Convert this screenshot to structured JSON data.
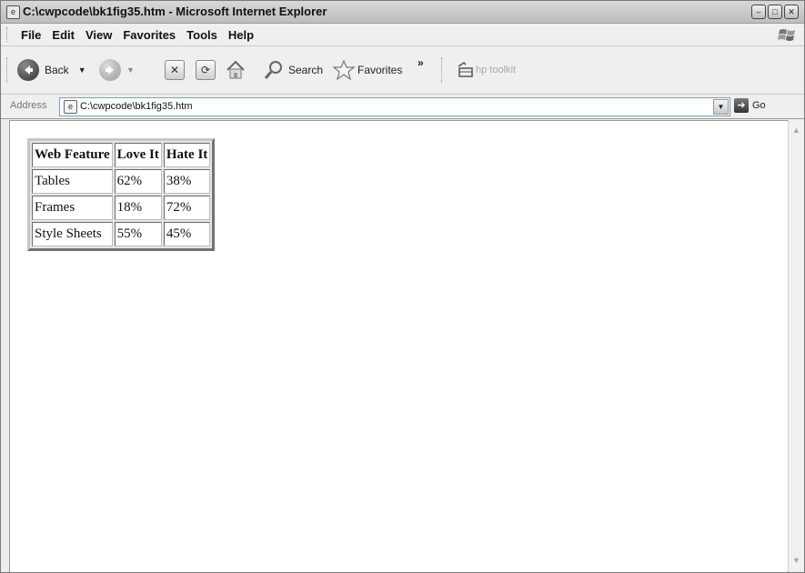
{
  "window": {
    "title": "C:\\cwpcode\\bk1fig35.htm - Microsoft Internet Explorer",
    "controls": [
      "minimize-icon",
      "maximize-icon",
      "close-icon"
    ]
  },
  "menu": {
    "items": [
      {
        "label": "File"
      },
      {
        "label": "Edit"
      },
      {
        "label": "View"
      },
      {
        "label": "Favorites"
      },
      {
        "label": "Tools"
      },
      {
        "label": "Help"
      }
    ]
  },
  "toolbar": {
    "back_label": "Back",
    "search_label": "Search",
    "favorites_label": "Favorites",
    "chevron": "»",
    "hp_label": "hp toolkit"
  },
  "address": {
    "label": "Address",
    "value": "C:\\cwpcode\\bk1fig35.htm",
    "go_label": "Go"
  },
  "table": {
    "headers": [
      "Web Feature",
      "Love It",
      "Hate It"
    ],
    "rows": [
      [
        "Tables",
        "62%",
        "38%"
      ],
      [
        "Frames",
        "18%",
        "72%"
      ],
      [
        "Style Sheets",
        "55%",
        "45%"
      ]
    ]
  }
}
